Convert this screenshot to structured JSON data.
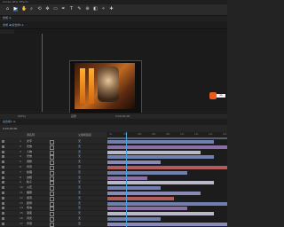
{
  "window": {
    "title": "Adobe After Effects"
  },
  "toolbar": {
    "tools": [
      {
        "icon": "home-icon",
        "glyph": "⌂"
      },
      {
        "icon": "selection-arrow-icon",
        "glyph": "▶"
      },
      {
        "icon": "hand-icon",
        "glyph": "✋"
      },
      {
        "icon": "zoom-icon",
        "glyph": "⌕"
      },
      {
        "icon": "orbit-icon",
        "glyph": "⟲"
      },
      {
        "icon": "pan-behind-icon",
        "glyph": "✥"
      },
      {
        "icon": "rectangle-icon",
        "glyph": "▭"
      },
      {
        "icon": "pen-icon",
        "glyph": "✒"
      },
      {
        "icon": "type-icon",
        "glyph": "T"
      },
      {
        "icon": "brush-icon",
        "glyph": "✎"
      },
      {
        "icon": "clone-stamp-icon",
        "glyph": "⊕"
      },
      {
        "icon": "eraser-icon",
        "glyph": "◧"
      },
      {
        "icon": "roto-brush-icon",
        "glyph": "✧"
      },
      {
        "icon": "puppet-pin-icon",
        "glyph": "✚"
      }
    ],
    "active_index": 1
  },
  "panel": {
    "tab": "合成 ≡"
  },
  "composition": {
    "label": "合成 ◀ 总合成1 ▸"
  },
  "viewer_footer": {
    "zoom": "(50%)",
    "resolution": "完整",
    "timecode": "0;00;00;00"
  },
  "extension": {
    "badge": "Ae"
  },
  "timeline": {
    "tab": "总合成1 ≡",
    "timecode": "0;00;00;00",
    "header": {
      "source_name": "源名称",
      "parent": "父级和链接"
    },
    "ruler_ticks": [
      "0s",
      "02s",
      "04s",
      "06s",
      "08s",
      "10s",
      "12s",
      "14s",
      "16s"
    ],
    "layers": [
      {
        "num": "1",
        "name": "文字",
        "parent": "无"
      },
      {
        "num": "2",
        "name": "光效",
        "parent": "无"
      },
      {
        "num": "3",
        "name": "人物",
        "parent": "无"
      },
      {
        "num": "4",
        "name": "光效",
        "parent": "无"
      },
      {
        "num": "5",
        "name": "调整",
        "parent": "无"
      },
      {
        "num": "6",
        "name": "背景",
        "parent": "无"
      },
      {
        "num": "7",
        "name": "纹理",
        "parent": "无"
      },
      {
        "num": "8",
        "name": "边框",
        "parent": "无"
      },
      {
        "num": "9",
        "name": "粒子",
        "parent": "无"
      },
      {
        "num": "10",
        "name": "火花",
        "parent": "无"
      },
      {
        "num": "11",
        "name": "烟雾",
        "parent": "无"
      },
      {
        "num": "12",
        "name": "遮罩",
        "parent": "无"
      },
      {
        "num": "13",
        "name": "装饰",
        "parent": "无"
      },
      {
        "num": "14",
        "name": "色块",
        "parent": "无"
      },
      {
        "num": "15",
        "name": "渐变",
        "parent": "无"
      },
      {
        "num": "16",
        "name": "闪光",
        "parent": "无"
      },
      {
        "num": "17",
        "name": "声音",
        "parent": "无"
      }
    ],
    "track_colors": [
      "#6f7fb0",
      "#8a6ea7",
      "#b8b8c8",
      "#6f7fb0",
      "#8a8ab8",
      "#b35a5a"
    ]
  }
}
